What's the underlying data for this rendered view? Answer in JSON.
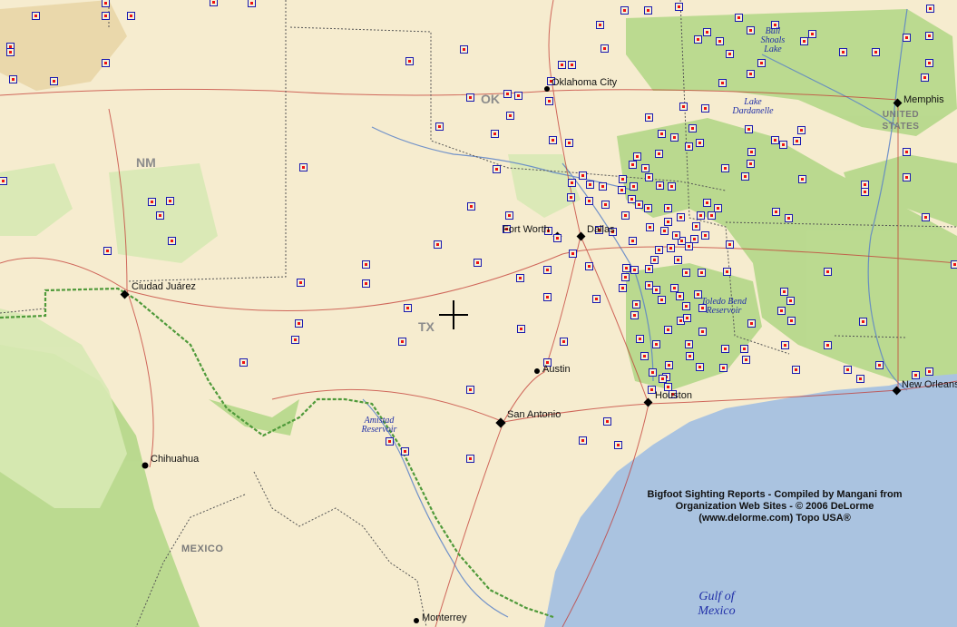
{
  "map": {
    "cities": [
      "Memphis",
      "Oklahoma City",
      "Fort Worth",
      "Dallas",
      "Ciudad Juárez",
      "Austin",
      "Houston",
      "San Antonio",
      "New Orleans",
      "Chihuahua",
      "Monterrey"
    ],
    "states": [
      "OK",
      "NM",
      "TX",
      "UNITED STATES"
    ],
    "country": "MEXICO",
    "water": {
      "bull_shoals": "Bull Shoals Lake",
      "dardanelle": "Lake Dardanelle",
      "toledo_bend": "Toledo Bend Reservoir",
      "amistad": "Amistad Reservoir",
      "gulf_1": "Gulf of",
      "gulf_2": "Mexico"
    },
    "credit": [
      "Bigfoot Sighting Reports - Compiled by Mangani from",
      "Organization Web Sites - © 2006 DeLorme",
      "(www.delorme.com) Topo USA®"
    ],
    "colors": {
      "land": "#f6eccf",
      "forest": "#b9da8e",
      "gulf": "#aac3e0",
      "marker_border": "#1a1ab0",
      "marker_dot": "#e11111"
    }
  }
}
